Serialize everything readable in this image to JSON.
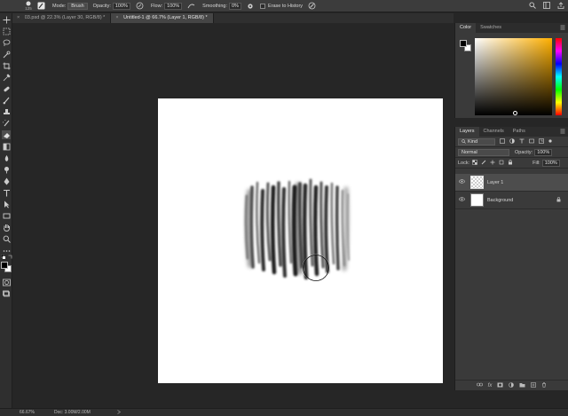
{
  "options_bar": {
    "brush_size": "125",
    "mode_label": "Mode:",
    "mode_value": "Brush",
    "opacity_label": "Opacity:",
    "opacity_value": "100%",
    "flow_label": "Flow:",
    "flow_value": "100%",
    "smoothing_label": "Smoothing:",
    "smoothing_value": "0%",
    "erase_to_history_label": "Erase to History"
  },
  "tabs": [
    {
      "label": "03.psd @ 22.3% (Layer 30, RGB/8) *",
      "close": "×",
      "active": false
    },
    {
      "label": "Untitled-1 @ 66.7% (Layer 1, RGB/8) *",
      "close": "×",
      "active": true
    }
  ],
  "color_panel": {
    "tabs": [
      "Color",
      "Swatches"
    ],
    "hue_color": "#ffb000"
  },
  "layers_panel": {
    "tabs": [
      "Layers",
      "Channels",
      "Paths"
    ],
    "filter_kind": "Kind",
    "blend_mode": "Normal",
    "opacity_label": "Opacity:",
    "opacity_value": "100%",
    "lock_label": "Lock:",
    "fill_label": "Fill:",
    "fill_value": "100%",
    "layers": [
      {
        "name": "Layer 1",
        "selected": true
      },
      {
        "name": "Background",
        "selected": false
      }
    ],
    "footer_icons": [
      "link-icon",
      "fx-icon",
      "mask-icon",
      "adjustment-icon",
      "folder-icon",
      "new-layer-icon",
      "trash-icon"
    ],
    "footer_fx": "fx"
  },
  "status_bar": {
    "zoom": "66.67%",
    "doc": "Doc: 3.00M/2.00M"
  },
  "colors": {
    "foreground": "#000000",
    "background": "#ffffff",
    "canvas": "#ffffff"
  }
}
